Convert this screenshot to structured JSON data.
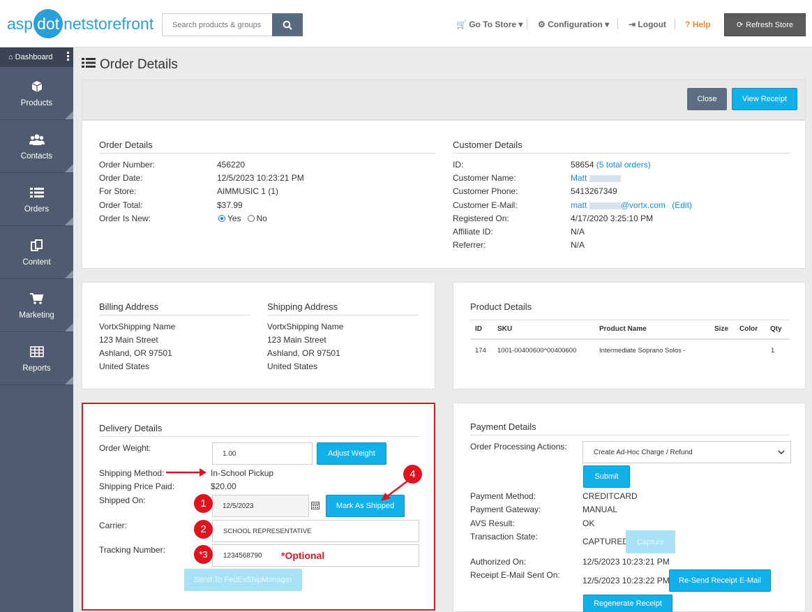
{
  "header": {
    "logo": {
      "part1": "asp",
      "part2": "dot",
      "part3": "net",
      "part4": "storefront"
    },
    "search_placeholder": "Search products & groups",
    "go_to_store": "Go To Store",
    "configuration": "Configuration",
    "logout": "Logout",
    "help": "Help",
    "refresh": "Refresh Store"
  },
  "sidebar": {
    "dashboard": "Dashboard",
    "items": [
      {
        "label": "Products",
        "icon": "cube-icon"
      },
      {
        "label": "Contacts",
        "icon": "users-icon"
      },
      {
        "label": "Orders",
        "icon": "list-icon"
      },
      {
        "label": "Content",
        "icon": "copy-icon"
      },
      {
        "label": "Marketing",
        "icon": "cart-icon"
      },
      {
        "label": "Reports",
        "icon": "table-icon"
      }
    ]
  },
  "page": {
    "title": "Order Details",
    "close": "Close",
    "view_receipt": "View Receipt"
  },
  "order": {
    "title": "Order Details",
    "number_label": "Order Number:",
    "number": "456220",
    "date_label": "Order Date:",
    "date": "12/5/2023 10:23:21 PM",
    "store_label": "For Store:",
    "store": "AIMMUSIC 1 (1)",
    "total_label": "Order Total:",
    "total": "$37.99",
    "isnew_label": "Order Is New:",
    "yes": "Yes",
    "no": "No"
  },
  "customer": {
    "title": "Customer Details",
    "id_label": "ID:",
    "id": "58654",
    "orders_link": "(5 total orders)",
    "name_label": "Customer Name:",
    "name": "Matt",
    "phone_label": "Customer Phone:",
    "phone": "5413267349",
    "email_label": "Customer E-Mail:",
    "email_prefix": "matt",
    "email_suffix": "@vortx.com",
    "edit": "(Edit)",
    "registered_label": "Registered On:",
    "registered": "4/17/2020 3:25:10 PM",
    "affiliate_label": "Affiliate ID:",
    "affiliate": "N/A",
    "referrer_label": "Referrer:",
    "referrer": "N/A"
  },
  "billing": {
    "title": "Billing Address",
    "lines": [
      "VortxShipping Name",
      "123 Main Street",
      "Ashland, OR 97501",
      "United States"
    ]
  },
  "shipping": {
    "title": "Shipping Address",
    "lines": [
      "VortxShipping Name",
      "123 Main Street",
      "Ashland, OR 97501",
      "United States"
    ]
  },
  "products": {
    "title": "Product Details",
    "headers": [
      "ID",
      "SKU",
      "Product Name",
      "Size",
      "Color",
      "Qty"
    ],
    "row": [
      "174",
      "1001-00400600^00400600",
      "Intermediate Soprano Solos -",
      "",
      "",
      "1"
    ]
  },
  "delivery": {
    "title": "Delivery Details",
    "weight_label": "Order Weight:",
    "weight": "1.00",
    "adjust": "Adjust Weight",
    "method_label": "Shipping Method:",
    "method": "In-School Pickup",
    "price_label": "Shipping Price Paid:",
    "price": "$20.00",
    "shipped_label": "Shipped On:",
    "shipped": "12/5/2023",
    "mark_shipped": "Mark As Shipped",
    "carrier_label": "Carrier:",
    "carrier": "SCHOOL REPRESENTATIVE",
    "tracking_label": "Tracking Number:",
    "tracking": "1234568790",
    "optional": "*Optional",
    "fedex": "Send To FedExShipManager",
    "badges": [
      "1",
      "2",
      "*3",
      "4"
    ]
  },
  "payment": {
    "title": "Payment Details",
    "actions_label": "Order Processing Actions:",
    "actions_value": "Create Ad-Hoc Charge / Refund",
    "submit": "Submit",
    "method_label": "Payment Method:",
    "method": "CREDITCARD",
    "gateway_label": "Payment Gateway:",
    "gateway": "MANUAL",
    "avs_label": "AVS Result:",
    "avs": "OK",
    "state_label": "Transaction State:",
    "state": "CAPTURED",
    "capture": "Capture",
    "authorized_label": "Authorized On:",
    "authorized": "12/5/2023 10:23:21 PM",
    "receipt_label": "Receipt E-Mail Sent On:",
    "receipt": "12/5/2023 10:23:22 PM",
    "resend": "Re-Send Receipt E-Mail",
    "regenerate": "Regenerate Receipt"
  },
  "colors": {
    "accent": "#12b0e8",
    "sidebar": "#4f5b6f",
    "annotation": "#e0141e",
    "help": "#f08c2c"
  }
}
